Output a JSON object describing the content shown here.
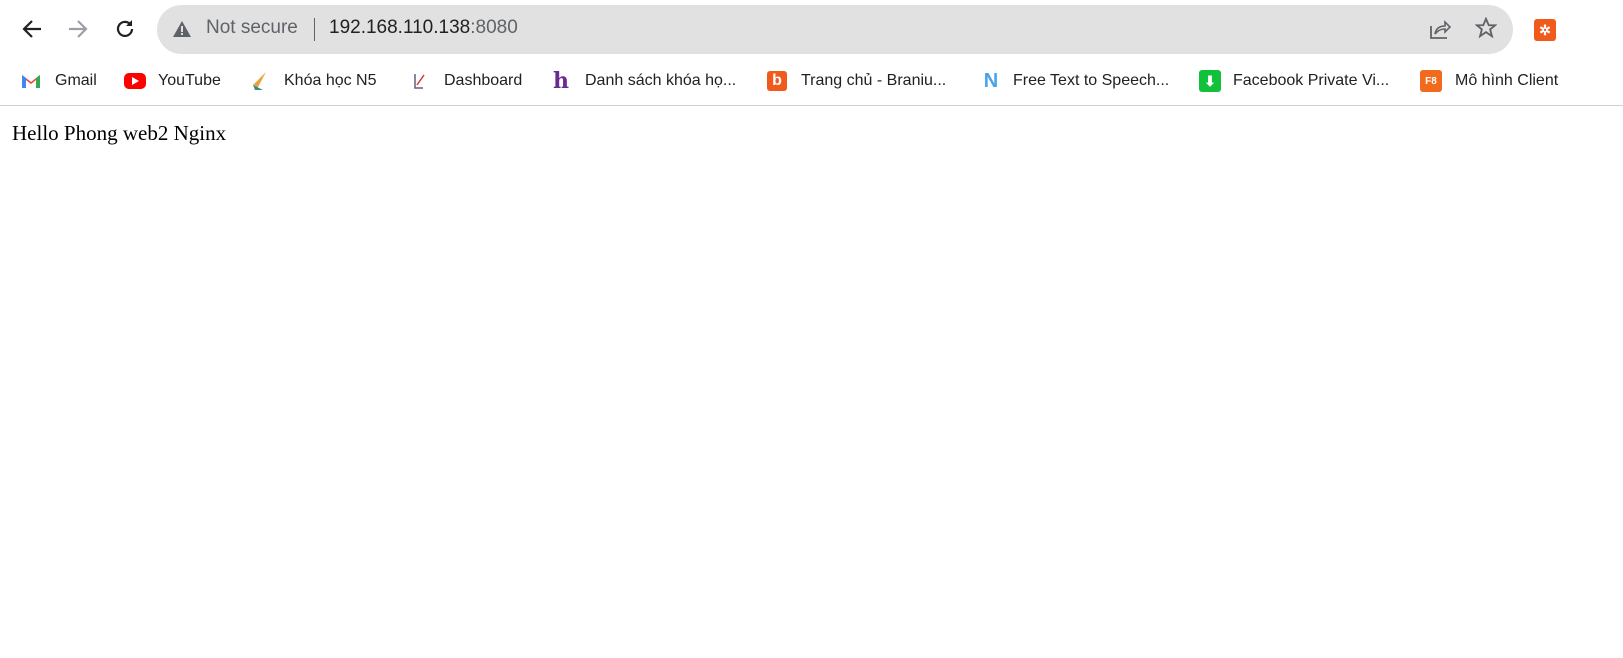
{
  "browser": {
    "security_label": "Not secure",
    "url_host": "192.168.110.138",
    "url_port": ":8080",
    "extension_icon_label": "✲"
  },
  "bookmarks": [
    {
      "label": "Gmail",
      "icon": "gmail-icon"
    },
    {
      "label": "YouTube",
      "icon": "youtube-icon"
    },
    {
      "label": "Khóa học N5",
      "icon": "khoa-hoc-icon"
    },
    {
      "label": "Dashboard",
      "icon": "dashboard-icon"
    },
    {
      "label": "Danh sách khóa họ...",
      "icon": "h-logo-icon",
      "icon_text": "h"
    },
    {
      "label": "Trang chủ - Braniu...",
      "icon": "b-logo-icon",
      "icon_text": "b"
    },
    {
      "label": "Free Text to Speech...",
      "icon": "n-logo-icon",
      "icon_text": "N"
    },
    {
      "label": "Facebook Private Vi...",
      "icon": "download-icon",
      "icon_text": "⬇"
    },
    {
      "label": "Mô hình Client",
      "icon": "f8-logo-icon",
      "icon_text": "F8"
    }
  ],
  "page": {
    "text": "Hello Phong web2 Nginx"
  }
}
